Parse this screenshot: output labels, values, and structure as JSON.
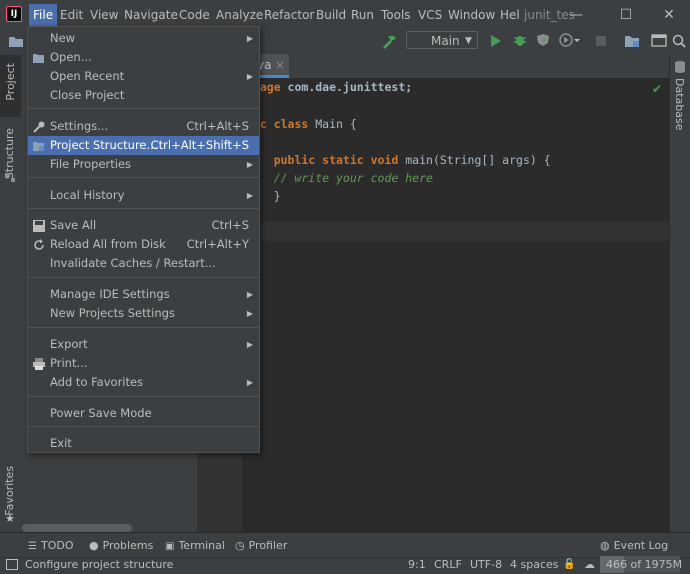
{
  "app": {
    "icon_letters": "IJ",
    "window_title": "junit_tes"
  },
  "menubar": {
    "items": [
      "File",
      "Edit",
      "View",
      "Navigate",
      "Code",
      "Analyze",
      "Refactor",
      "Build",
      "Run",
      "Tools",
      "VCS",
      "Window",
      "Hel"
    ]
  },
  "window_controls": {
    "minimize": "—",
    "maximize": "☐",
    "close": "✕"
  },
  "toolbar": {
    "run_config": "Main",
    "run_config_arrow": "▼"
  },
  "left_tabs": {
    "project": "Project",
    "structure": "Structure",
    "favorites": "Favorites"
  },
  "right_tabs": {
    "database": "Database"
  },
  "editor": {
    "tab_label": "va",
    "tab_close": "×",
    "lines": [
      {
        "a": "ckage ",
        "b": "com.dae.junittest;"
      },
      {
        "a": "lic class ",
        "b": "Main {"
      },
      {
        "a": "    public static void ",
        "b": "main(String[] args) {"
      },
      {
        "c": "    // write your code here"
      },
      {
        "b": "    }"
      }
    ]
  },
  "file_menu": {
    "items": [
      {
        "label": "New",
        "shortcut": "",
        "submenu": true
      },
      {
        "label": "Open...",
        "shortcut": "",
        "submenu": false
      },
      {
        "label": "Open Recent",
        "shortcut": "",
        "submenu": true
      },
      {
        "label": "Close Project",
        "shortcut": "",
        "submenu": false
      },
      {
        "label": "Settings...",
        "shortcut": "Ctrl+Alt+S",
        "submenu": false
      },
      {
        "label": "Project Structure...",
        "shortcut": "Ctrl+Alt+Shift+S",
        "submenu": false
      },
      {
        "label": "File Properties",
        "shortcut": "",
        "submenu": true
      },
      {
        "label": "Local History",
        "shortcut": "",
        "submenu": true
      },
      {
        "label": "Save All",
        "shortcut": "Ctrl+S",
        "submenu": false
      },
      {
        "label": "Reload All from Disk",
        "shortcut": "Ctrl+Alt+Y",
        "submenu": false
      },
      {
        "label": "Invalidate Caches / Restart...",
        "shortcut": "",
        "submenu": false
      },
      {
        "label": "Manage IDE Settings",
        "shortcut": "",
        "submenu": true
      },
      {
        "label": "New Projects Settings",
        "shortcut": "",
        "submenu": true
      },
      {
        "label": "Export",
        "shortcut": "",
        "submenu": true
      },
      {
        "label": "Print...",
        "shortcut": "",
        "submenu": false
      },
      {
        "label": "Add to Favorites",
        "shortcut": "",
        "submenu": true
      },
      {
        "label": "Power Save Mode",
        "shortcut": "",
        "submenu": false
      },
      {
        "label": "Exit",
        "shortcut": "",
        "submenu": false
      }
    ]
  },
  "bottom_tools": {
    "todo": "TODO",
    "problems": "Problems",
    "terminal": "Terminal",
    "profiler": "Profiler",
    "event_log": "Event Log"
  },
  "status": {
    "message": "Configure project structure",
    "position": "9:1",
    "line_sep": "CRLF",
    "encoding": "UTF-8",
    "indent": "4 spaces",
    "memory": "466 of 1975M"
  },
  "colors": {
    "accent": "#4b6eaf",
    "run_green": "#499c54",
    "keyword": "#cc7832"
  }
}
